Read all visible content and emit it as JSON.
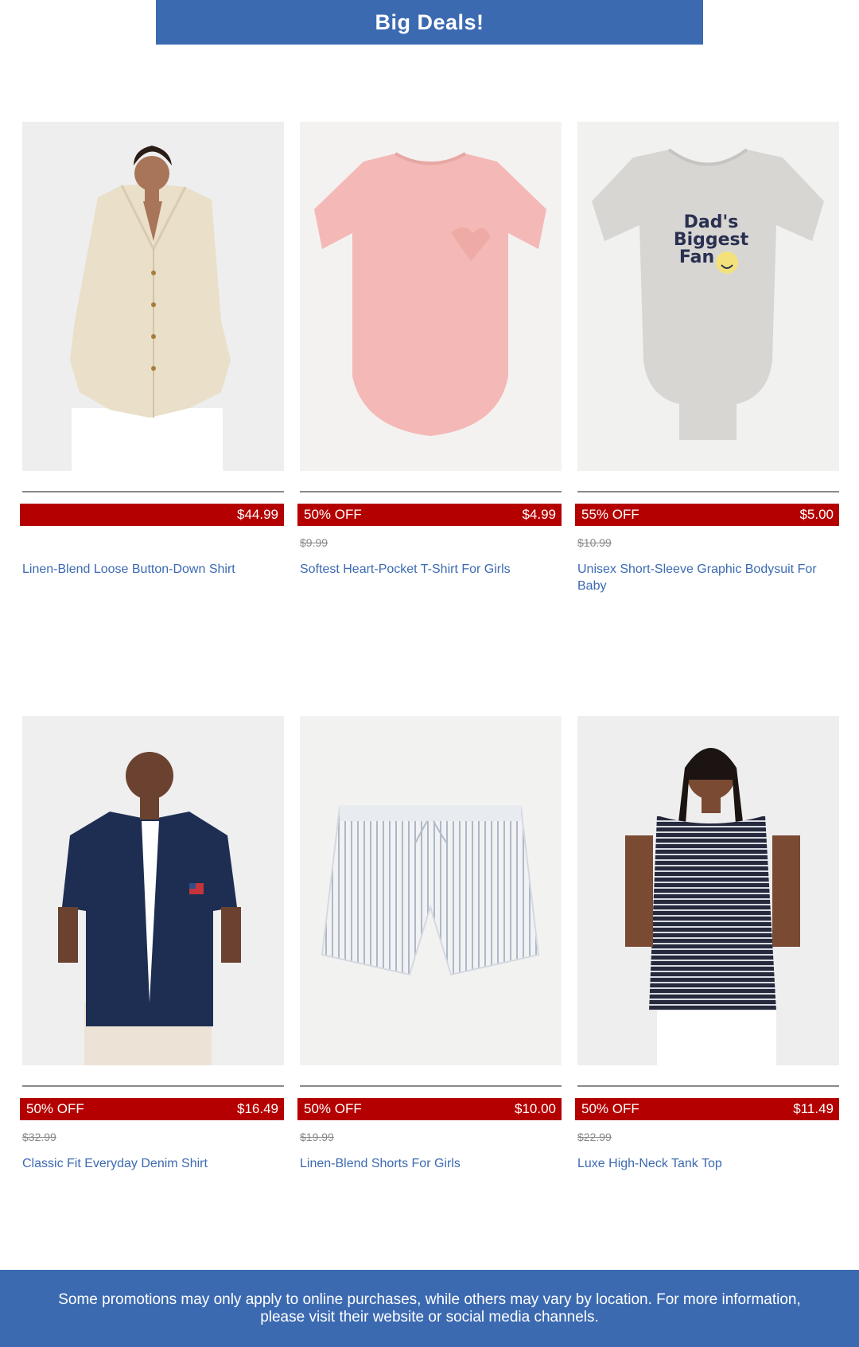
{
  "banner": {
    "title": "Big Deals!"
  },
  "products": [
    {
      "discount": "",
      "price": "$44.99",
      "original_price": "",
      "name": "Linen-Blend Loose Button-Down Shirt",
      "image": "woman-linen-shirt-photo"
    },
    {
      "discount": "50% OFF",
      "price": "$4.99",
      "original_price": "$9.99",
      "name": "Softest Heart-Pocket T-Shirt For Girls",
      "image": "pink-tshirt-photo"
    },
    {
      "discount": "55% OFF",
      "price": "$5.00",
      "original_price": "$10.99",
      "name": "Unisex Short-Sleeve Graphic Bodysuit For Baby",
      "image": "baby-bodysuit-photo",
      "graphic_text": [
        "Dad's",
        "Biggest",
        "Fan"
      ]
    },
    {
      "discount": "50% OFF",
      "price": "$16.49",
      "original_price": "$32.99",
      "name": "Classic Fit Everyday Denim Shirt",
      "image": "man-denim-shirt-photo"
    },
    {
      "discount": "50% OFF",
      "price": "$10.00",
      "original_price": "$19.99",
      "name": "Linen-Blend Shorts For Girls",
      "image": "striped-shorts-photo"
    },
    {
      "discount": "50% OFF",
      "price": "$11.49",
      "original_price": "$22.99",
      "name": "Luxe High-Neck Tank Top",
      "image": "woman-striped-tank-photo"
    }
  ],
  "footer": {
    "text": "Some promotions may only apply to online purchases, while others may vary by location. For more information, please visit their website or social media channels."
  },
  "colors": {
    "brand_blue": "#3c6ab1",
    "sale_red": "#b40000"
  }
}
